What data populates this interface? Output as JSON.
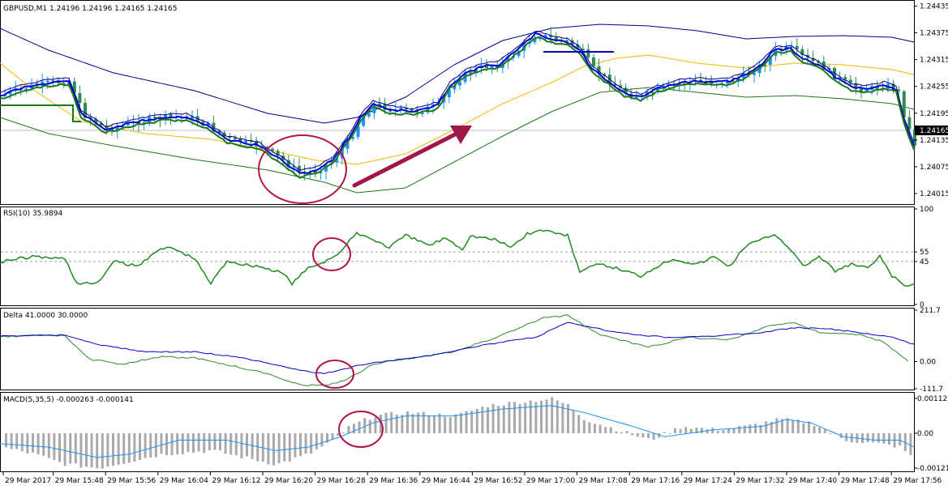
{
  "chart_data": [
    {
      "type": "candlestick",
      "title": "GBPUSD,M1  1.24196 1.24196 1.24165 1.24165",
      "y_ticks": [
        "1.24435",
        "1.24375",
        "1.24315",
        "1.24255",
        "1.24195",
        "1.24135",
        "1.24075",
        "1.24015"
      ],
      "ylim": [
        1.23995,
        1.24445
      ],
      "current_price": "1.24165",
      "colors": {
        "bull": "#1e90ff",
        "bear": "#2e8b57",
        "ma_fast": "#0000cd",
        "ma_slow": "#006400",
        "ma_gold": "#ffc000",
        "band": "#00008b"
      }
    },
    {
      "type": "line",
      "title": "RSI(10) 35.9894",
      "y_ticks": [
        "100",
        "55",
        "45",
        "0"
      ],
      "ylim": [
        0,
        100
      ],
      "levels": [
        55,
        45
      ],
      "colors": {
        "line": "#1f8a1f"
      }
    },
    {
      "type": "line",
      "title": "Delta 41.0000 30.0000",
      "y_ticks": [
        "211.7",
        "0.00",
        "-111.7"
      ],
      "ylim": [
        -111.7,
        211.7
      ],
      "colors": {
        "fast": "#2e8b2e",
        "slow": "#0000cd"
      }
    },
    {
      "type": "bar",
      "title": "MACD(5,35,5) -0.000263 -0.000141",
      "y_ticks": [
        "0.001122",
        "0.00",
        "-0.00121"
      ],
      "ylim": [
        -0.00121,
        0.001122
      ],
      "colors": {
        "hist": "#a9a9a9",
        "signal": "#1e90ff"
      }
    }
  ],
  "time_labels": [
    "29 Mar 2017",
    "29 Mar 15:48",
    "29 Mar 15:56",
    "29 Mar 16:04",
    "29 Mar 16:12",
    "29 Mar 16:20",
    "29 Mar 16:28",
    "29 Mar 16:36",
    "29 Mar 16:44",
    "29 Mar 16:52",
    "29 Mar 17:00",
    "29 Mar 17:08",
    "29 Mar 17:16",
    "29 Mar 17:24",
    "29 Mar 17:32",
    "29 Mar 17:40",
    "29 Mar 17:48",
    "29 Mar 17:56"
  ]
}
